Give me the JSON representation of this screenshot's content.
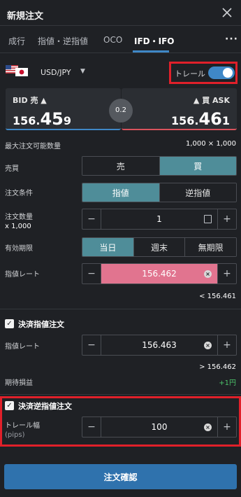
{
  "header": {
    "title": "新規注文"
  },
  "tabs": [
    {
      "label": "成行"
    },
    {
      "label": "指値・逆指値"
    },
    {
      "label": "OCO"
    },
    {
      "label": "IFD・IFO"
    }
  ],
  "more_label": "···",
  "pair": {
    "label": "USD/JPY",
    "caret": "▼"
  },
  "trail": {
    "label": "トレール",
    "on": true
  },
  "bid": {
    "label": "BID 売 ▲",
    "price_prefix": "156.",
    "price_big": "45",
    "price_suffix": "9"
  },
  "ask": {
    "label": "▲ 買 ASK",
    "price_prefix": "156.",
    "price_big": "46",
    "price_suffix": "1"
  },
  "spread": "0.2",
  "max_qty": {
    "label": "最大注文可能数量",
    "value": "1,000 × 1,000"
  },
  "side": {
    "label": "売買",
    "options": [
      "売",
      "買"
    ],
    "selected": "買"
  },
  "condition": {
    "label": "注文条件",
    "options": [
      "指値",
      "逆指値"
    ],
    "selected": "指値"
  },
  "quantity": {
    "label": "注文数量",
    "sublabel": "x 1,000",
    "value": "1"
  },
  "expiry": {
    "label": "有効期限",
    "options": [
      "当日",
      "週末",
      "無期限"
    ],
    "selected": "当日"
  },
  "limit_rate": {
    "label": "指値レート",
    "value": "156.462",
    "hint": "< 156.461"
  },
  "settle_limit": {
    "title": "決済指値注文",
    "rate_label": "指値レート",
    "value": "156.463",
    "hint": "> 156.462",
    "expected_label": "期待損益",
    "expected_value": "+1円"
  },
  "settle_stop": {
    "title": "決済逆指値注文",
    "trail_label": "トレール幅",
    "trail_sublabel": "(pips)",
    "value": "100"
  },
  "confirm_label": "注文確認",
  "colors": {
    "accent": "#3f88c7",
    "selected": "#4f8d99",
    "highlight": "#e0202a",
    "limit_field": "#e1748f",
    "profit": "#4cc36a"
  }
}
